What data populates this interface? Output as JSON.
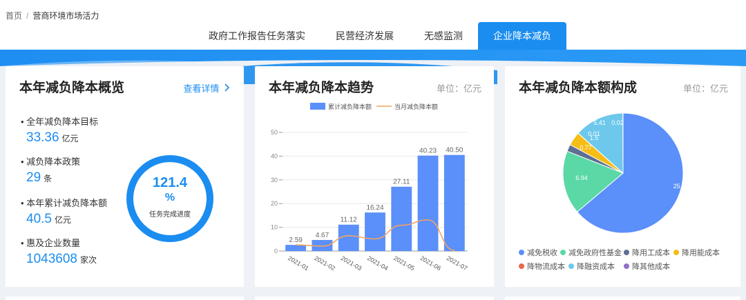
{
  "breadcrumb": {
    "home": "首页",
    "separator": "/",
    "current": "营商环境市场活力"
  },
  "tabs": [
    {
      "label": "政府工作报告任务落实",
      "active": false
    },
    {
      "label": "民营经济发展",
      "active": false
    },
    {
      "label": "无感监测",
      "active": false
    },
    {
      "label": "企业降本减负",
      "active": true
    }
  ],
  "colors": {
    "accent": "#1b8df0",
    "bar": "#5b8ff9",
    "line": "#f4a460"
  },
  "overview": {
    "title": "本年减负降本概览",
    "detail_link": "查看详情",
    "stats": [
      {
        "label": "全年减负降本目标",
        "value": "33.36",
        "unit": "亿元"
      },
      {
        "label": "减负降本政策",
        "value": "29",
        "unit": "条"
      },
      {
        "label": "本年累计减负降本额",
        "value": "40.5",
        "unit": "亿元"
      },
      {
        "label": "惠及企业数量",
        "value": "1043608",
        "unit": "家次"
      }
    ],
    "progress": {
      "value": "121.4",
      "symbol": "%",
      "label": "任务完成进度",
      "fraction": 1.0
    }
  },
  "trend": {
    "title": "本年减负降本趋势",
    "unit": "单位：亿元"
  },
  "composition": {
    "title": "本年减负降本额构成",
    "unit": "单位：亿元"
  },
  "chart_data": [
    {
      "type": "bar",
      "categories": [
        "2021-01",
        "2021-02",
        "2021-03",
        "2021-04",
        "2021-05",
        "2021-06",
        "2021-07"
      ],
      "series": [
        {
          "name": "累计减负降本额",
          "type": "bar",
          "values": [
            2.59,
            4.67,
            11.12,
            16.24,
            27.11,
            40.23,
            40.5
          ],
          "labels": [
            "2.59",
            "4.67",
            "11.12",
            "16.24",
            "27.11",
            "40.23",
            "40.50"
          ]
        },
        {
          "name": "当月减负降本额",
          "type": "line",
          "values": [
            2.59,
            2.08,
            6.45,
            5.12,
            10.87,
            13.12,
            0.27
          ]
        }
      ],
      "ylim": [
        0,
        50
      ],
      "yticks": [
        "0",
        "10",
        "20",
        "30",
        "40",
        "50"
      ],
      "grid": true,
      "legend": "top"
    },
    {
      "type": "pie",
      "slices": [
        {
          "name": "减免税收",
          "value": 25.83,
          "label": "25.83",
          "color": "#5b8ff9"
        },
        {
          "name": "减免政府性基金",
          "value": 6.94,
          "label": "6.94",
          "color": "#5ad8a6"
        },
        {
          "name": "降用工成本",
          "value": 0.77,
          "label": "0.77",
          "color": "#5d7092"
        },
        {
          "name": "降用能成本",
          "value": 1.5,
          "label": "1.5",
          "color": "#f6bd16"
        },
        {
          "name": "降物流成本",
          "value": 0.01,
          "label": "0.01",
          "color": "#e8684a"
        },
        {
          "name": "降融资成本",
          "value": 5.41,
          "label": "5.41",
          "color": "#6dc8ec"
        },
        {
          "name": "降其他成本",
          "value": 0.02,
          "label": "0.02",
          "color": "#9270ca"
        }
      ],
      "legend": "bottom"
    }
  ]
}
